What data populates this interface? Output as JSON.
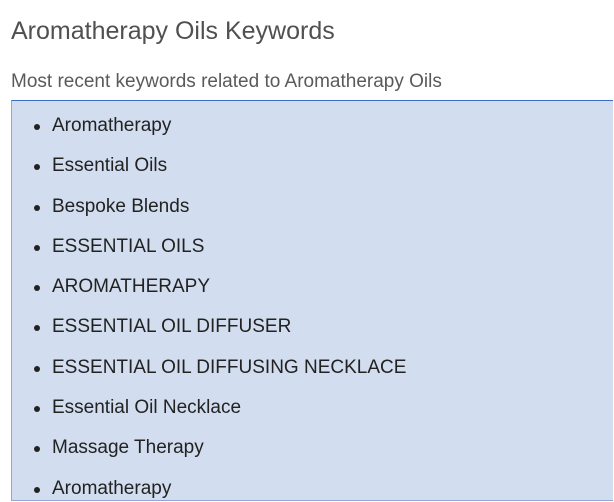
{
  "page": {
    "title": "Aromatherapy Oils Keywords",
    "subtitle": "Most recent keywords related to Aromatherapy Oils"
  },
  "keywords": [
    "Aromatherapy",
    "Essential Oils",
    "Bespoke Blends",
    "ESSENTIAL OILS",
    "AROMATHERAPY",
    "ESSENTIAL OIL DIFFUSER",
    "ESSENTIAL OIL DIFFUSING NECKLACE",
    "Essential Oil Necklace",
    "Massage Therapy",
    "Aromatherapy"
  ],
  "colors": {
    "panel_background": "#d2ddef",
    "panel_border": "#3c6fc4",
    "title_text": "#505050",
    "body_text": "#222222"
  }
}
